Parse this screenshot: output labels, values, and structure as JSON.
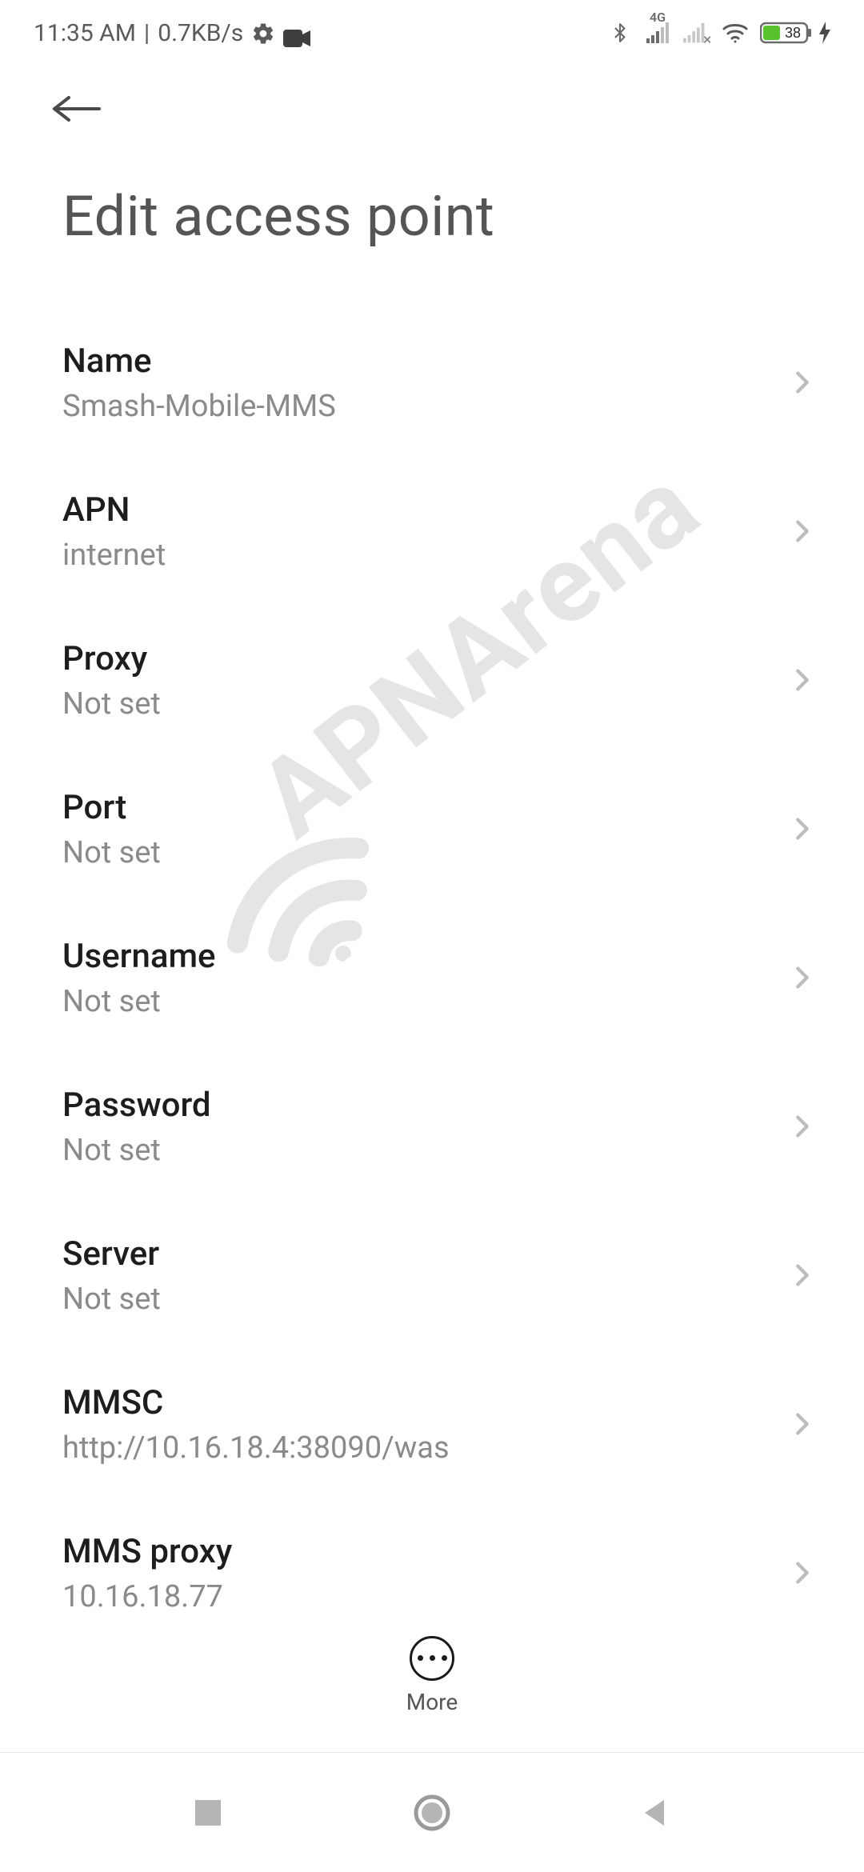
{
  "status": {
    "time": "11:35 AM",
    "sep": "|",
    "speed": "0.7KB/s",
    "battery_text": "38",
    "network_badge": "4G"
  },
  "header": {
    "title": "Edit access point"
  },
  "rows": [
    {
      "label": "Name",
      "value": "Smash-Mobile-MMS"
    },
    {
      "label": "APN",
      "value": "internet"
    },
    {
      "label": "Proxy",
      "value": "Not set"
    },
    {
      "label": "Port",
      "value": "Not set"
    },
    {
      "label": "Username",
      "value": "Not set"
    },
    {
      "label": "Password",
      "value": "Not set"
    },
    {
      "label": "Server",
      "value": "Not set"
    },
    {
      "label": "MMSC",
      "value": "http://10.16.18.4:38090/was"
    },
    {
      "label": "MMS proxy",
      "value": "10.16.18.77"
    }
  ],
  "more": {
    "label": "More"
  },
  "watermark": {
    "text": "APNArena"
  }
}
